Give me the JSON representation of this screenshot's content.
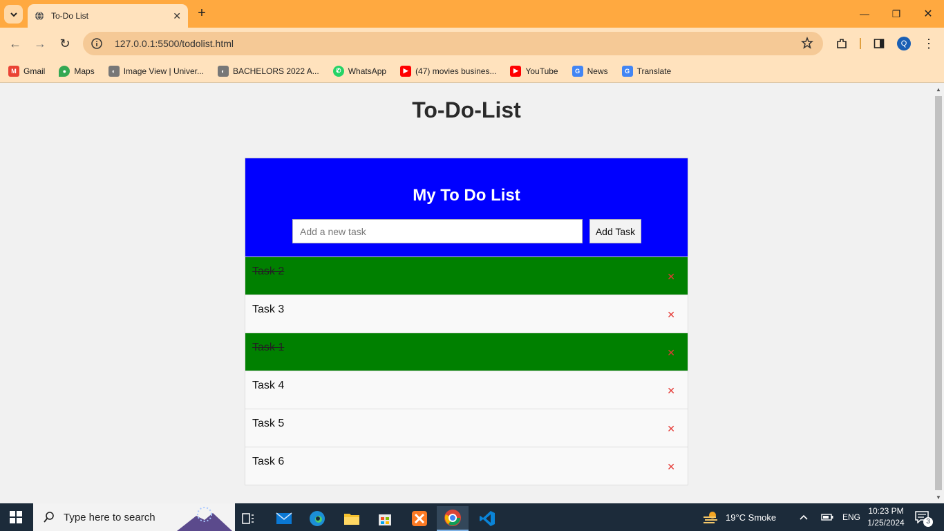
{
  "browser": {
    "tab_title": "To-Do List",
    "url": "127.0.0.1:5500/todolist.html",
    "bookmarks": [
      {
        "label": "Gmail",
        "icon": "gmail-icon",
        "color": "#ea4335"
      },
      {
        "label": "Maps",
        "icon": "maps-icon",
        "color": "#34a853"
      },
      {
        "label": "Image View | Univer...",
        "icon": "image-view-icon",
        "color": "#555555"
      },
      {
        "label": "BACHELORS 2022 A...",
        "icon": "bachelors-icon",
        "color": "#555555"
      },
      {
        "label": "WhatsApp",
        "icon": "whatsapp-icon",
        "color": "#25d366"
      },
      {
        "label": "(47) movies busines...",
        "icon": "youtube-icon",
        "color": "#ff0000"
      },
      {
        "label": "YouTube",
        "icon": "youtube-icon",
        "color": "#ff0000"
      },
      {
        "label": "News",
        "icon": "news-icon",
        "color": "#4285f4"
      },
      {
        "label": "Translate",
        "icon": "translate-icon",
        "color": "#4285f4"
      }
    ],
    "profile_initial": "Q"
  },
  "page": {
    "heading": "To-Do-List",
    "card_title": "My To Do List",
    "input_placeholder": "Add a new task",
    "add_button_label": "Add Task",
    "delete_glyph": "✕",
    "tasks": [
      {
        "label": "Task 2",
        "done": true
      },
      {
        "label": "Task 3",
        "done": false
      },
      {
        "label": "Task 1",
        "done": true
      },
      {
        "label": "Task 4",
        "done": false
      },
      {
        "label": "Task 5",
        "done": false
      },
      {
        "label": "Task 6",
        "done": false
      }
    ]
  },
  "colors": {
    "tabstrip": "#ffa940",
    "header_bg": "#0000ff",
    "done_bg": "#008000",
    "delete": "#e53935"
  },
  "taskbar": {
    "search_placeholder": "Type here to search",
    "weather": "19°C  Smoke",
    "language": "ENG",
    "time": "10:23 PM",
    "date": "1/25/2024",
    "notifications": "3"
  }
}
